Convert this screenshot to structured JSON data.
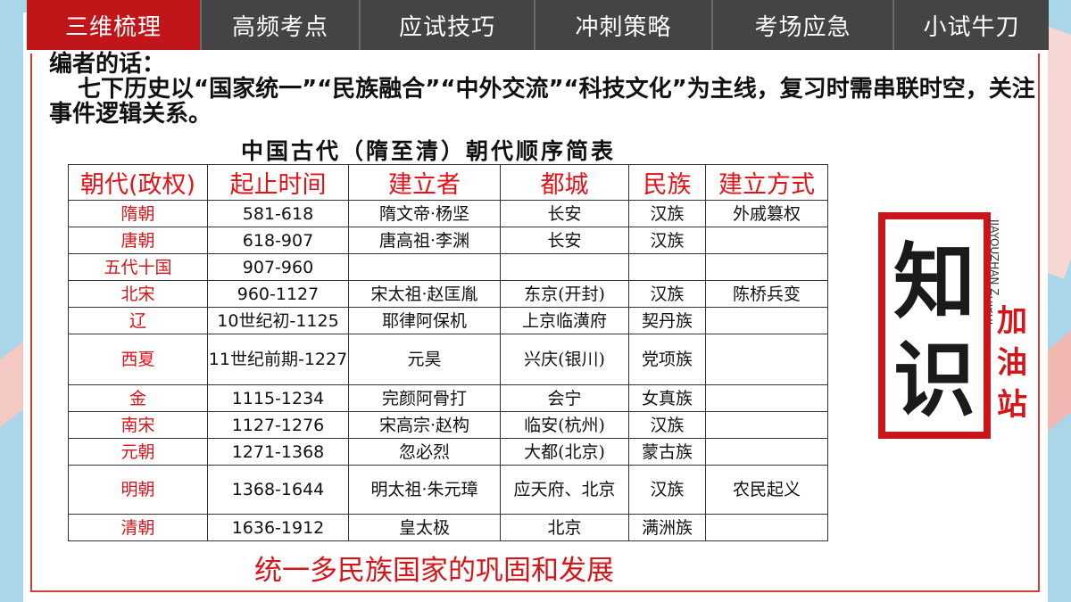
{
  "nav": {
    "tabs": [
      {
        "label": "三维梳理",
        "active": true
      },
      {
        "label": "高频考点",
        "active": false
      },
      {
        "label": "应试技巧",
        "active": false
      },
      {
        "label": "冲刺策略",
        "active": false
      },
      {
        "label": "考场应急",
        "active": false
      },
      {
        "label": "小试牛刀",
        "active": false
      }
    ]
  },
  "intro": {
    "heading": "编者的话：",
    "body": "七下历史以“国家统一”“民族融合”“中外交流”“科技文化”为主线，复习时需串联时空，关注事件逻辑关系。"
  },
  "table": {
    "title": "中国古代（隋至清）朝代顺序简表",
    "headers": [
      "朝代(政权)",
      "起止时间",
      "建立者",
      "都城",
      "民族",
      "建立方式"
    ],
    "rows": [
      [
        "隋朝",
        "581-618",
        "隋文帝·杨坚",
        "长安",
        "汉族",
        "外戚篡权"
      ],
      [
        "唐朝",
        "618-907",
        "唐高祖·李渊",
        "长安",
        "汉族",
        ""
      ],
      [
        "五代十国",
        "907-960",
        "",
        "",
        "",
        ""
      ],
      [
        "北宋",
        "960-1127",
        "宋太祖·赵匡胤",
        "东京(开封)",
        "汉族",
        "陈桥兵变"
      ],
      [
        "辽",
        "10世纪初-1125",
        "耶律阿保机",
        "上京临潢府",
        "契丹族",
        ""
      ],
      [
        "西夏",
        "11世纪前期-1227",
        "元昊",
        "兴庆(银川)",
        "党项族",
        ""
      ],
      [
        "金",
        "1115-1234",
        "完颜阿骨打",
        "会宁",
        "女真族",
        ""
      ],
      [
        "南宋",
        "1127-1276",
        "宋高宗·赵构",
        "临安(杭州)",
        "汉族",
        ""
      ],
      [
        "元朝",
        "1271-1368",
        "忽必烈",
        "大都(北京)",
        "蒙古族",
        ""
      ],
      [
        "明朝",
        "1368-1644",
        "明太祖·朱元璋",
        "应天府、北京",
        "汉族",
        "农民起义"
      ],
      [
        "清朝",
        "1636-1912",
        "皇太极",
        "北京",
        "满洲族",
        ""
      ]
    ]
  },
  "caption": "统一多民族国家的巩固和发展",
  "logo": {
    "big_text": "知识",
    "small_text": "加油站",
    "vertical_text": "JIAYOUZHAN ZHISHI"
  },
  "colors": {
    "accent": "#c0161a",
    "tab_bg": "#444444",
    "label_red": "#d4161b"
  }
}
